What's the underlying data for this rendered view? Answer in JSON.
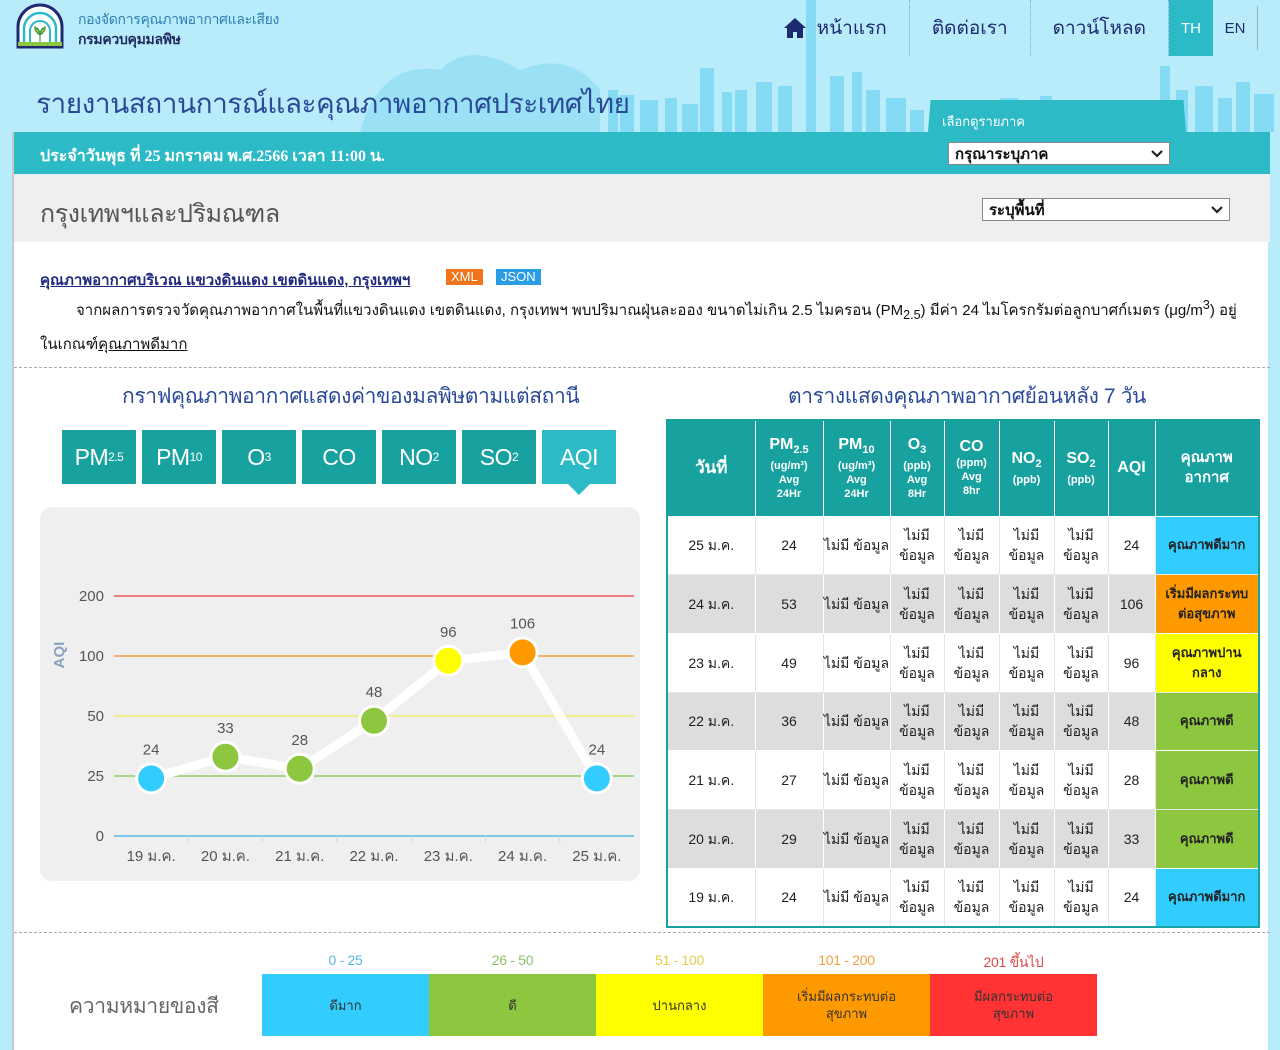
{
  "header": {
    "logo_line1": "กองจัดการคุณภาพอากาศและเสียง",
    "logo_line2": "กรมควบคุมมลพิษ",
    "site_title": "รายงานสถานการณ์และคุณภาพอากาศประเทศไทย",
    "nav": [
      {
        "label": "หน้าแรก",
        "icon": "home-icon"
      },
      {
        "label": "ติดต่อเรา"
      },
      {
        "label": "ดาวน์โหลด"
      }
    ],
    "languages": [
      {
        "label": "TH",
        "active": true
      },
      {
        "label": "EN",
        "active": false
      }
    ],
    "region_tab_label": "เลือกดูรายภาค",
    "region_select_value": "กรุณาระบุภาค"
  },
  "date_bar": {
    "text": "ประจำวันพุธ ที่ 25 มกราคม พ.ศ.2566 เวลา 11:00 น."
  },
  "area": {
    "title": "กรุงเทพฯและปริมณฑล",
    "select_value": "ระบุพื้นที่"
  },
  "info": {
    "link_text": "คุณภาพอากาศบริเวณ แขวงดินแดง เขตดินแดง, กรุงเทพฯ",
    "badge_xml": "XML",
    "badge_json": "JSON",
    "desc_part1": "จากผลการตรวจวัดคุณภาพอากาศในพื้นที่แขวงดินแดง เขตดินแดง, กรุงเทพฯ พบปริมาณฝุ่นละออง ขนาดไม่เกิน 2.5 ไมครอน (PM",
    "desc_sub": "2.5",
    "desc_part2": ") มีค่า 24 ไมโครกรัมต่อลูกบาศก์เมตร (μg/m",
    "desc_sup": "3",
    "desc_part3": ") อยู่ในเกณฑ์",
    "desc_quality": "คุณภาพดีมาก"
  },
  "chart_section": {
    "title": "กราฟคุณภาพอากาศแสดงค่าของมลพิษตามแต่สถานี",
    "tabs": [
      {
        "main": "PM",
        "sub": "2.5",
        "active": false
      },
      {
        "main": "PM",
        "sub": "10",
        "active": false
      },
      {
        "main": "O",
        "sub": "3",
        "active": false
      },
      {
        "main": "CO",
        "sub": "",
        "active": false
      },
      {
        "main": "NO",
        "sub": "2",
        "active": false
      },
      {
        "main": "SO",
        "sub": "2",
        "active": false
      },
      {
        "main": "AQI",
        "sub": "",
        "active": true
      }
    ]
  },
  "chart_data": {
    "type": "line",
    "title": "",
    "xlabel": "",
    "ylabel": "AQI",
    "categories": [
      "19 ม.ค.",
      "20 ม.ค.",
      "21 ม.ค.",
      "22 ม.ค.",
      "23 ม.ค.",
      "24 ม.ค.",
      "25 ม.ค."
    ],
    "series": [
      {
        "name": "AQI",
        "values": [
          24,
          33,
          28,
          48,
          96,
          106,
          24
        ]
      }
    ],
    "y_ticks": [
      0,
      25,
      50,
      100,
      200
    ],
    "y_tick_labels": [
      "0",
      "25",
      "50",
      "100",
      "200"
    ],
    "threshold_lines": [
      {
        "value": 0,
        "color": "#7fc8e8"
      },
      {
        "value": 25,
        "color": "#a9d48a"
      },
      {
        "value": 50,
        "color": "#eef08c"
      },
      {
        "value": 100,
        "color": "#f2b26c"
      },
      {
        "value": 200,
        "color": "#f08080"
      }
    ],
    "point_colors": [
      "#33ccff",
      "#8dc63f",
      "#8dc63f",
      "#8dc63f",
      "#ffff00",
      "#ff9900",
      "#33ccff"
    ],
    "scale": "piecewise",
    "grid": true,
    "legend": "none"
  },
  "table_section": {
    "title": "ตารางแสดงคุณภาพอากาศย้อนหลัง 7 วัน",
    "headers": {
      "date": "วันที่",
      "pm25": {
        "name": "PM",
        "sub": "2.5",
        "unit": "(ug/m³)",
        "avg": "Avg",
        "period": "24Hr"
      },
      "pm10": {
        "name": "PM",
        "sub": "10",
        "unit": "(ug/m³)",
        "avg": "Avg",
        "period": "24Hr"
      },
      "o3": {
        "name": "O",
        "sub": "3",
        "unit": "(ppb)",
        "avg": "Avg",
        "period": "8Hr"
      },
      "co": {
        "name": "CO",
        "sub": "",
        "unit": "(ppm)",
        "avg": "Avg",
        "period": "8hr"
      },
      "no2": {
        "name": "NO",
        "sub": "2",
        "unit": "(ppb)"
      },
      "so2": {
        "name": "SO",
        "sub": "2",
        "unit": "(ppb)"
      },
      "aqi": "AQI",
      "quality_line1": "คุณภาพ",
      "quality_line2": "อากาศ"
    },
    "rows": [
      {
        "date": "25 ม.ค.",
        "pm25": "24",
        "pm10": "ไม่มี ข้อมูล",
        "o3": "ไม่มี ข้อมูล",
        "co": "ไม่มี ข้อมูล",
        "no2": "ไม่มี ข้อมูล",
        "so2": "ไม่มี ข้อมูล",
        "aqi": "24",
        "quality": "คุณภาพดีมาก",
        "quality_color": "#33ccff"
      },
      {
        "date": "24 ม.ค.",
        "pm25": "53",
        "pm10": "ไม่มี ข้อมูล",
        "o3": "ไม่มี ข้อมูล",
        "co": "ไม่มี ข้อมูล",
        "no2": "ไม่มี ข้อมูล",
        "so2": "ไม่มี ข้อมูล",
        "aqi": "106",
        "quality": "เริ่มมีผลกระทบต่อสุขภาพ",
        "quality_color": "#ff9900"
      },
      {
        "date": "23 ม.ค.",
        "pm25": "49",
        "pm10": "ไม่มี ข้อมูล",
        "o3": "ไม่มี ข้อมูล",
        "co": "ไม่มี ข้อมูล",
        "no2": "ไม่มี ข้อมูล",
        "so2": "ไม่มี ข้อมูล",
        "aqi": "96",
        "quality": "คุณภาพปานกลาง",
        "quality_color": "#ffff00"
      },
      {
        "date": "22 ม.ค.",
        "pm25": "36",
        "pm10": "ไม่มี ข้อมูล",
        "o3": "ไม่มี ข้อมูล",
        "co": "ไม่มี ข้อมูล",
        "no2": "ไม่มี ข้อมูล",
        "so2": "ไม่มี ข้อมูล",
        "aqi": "48",
        "quality": "คุณภาพดี",
        "quality_color": "#8dc63f"
      },
      {
        "date": "21 ม.ค.",
        "pm25": "27",
        "pm10": "ไม่มี ข้อมูล",
        "o3": "ไม่มี ข้อมูล",
        "co": "ไม่มี ข้อมูล",
        "no2": "ไม่มี ข้อมูล",
        "so2": "ไม่มี ข้อมูล",
        "aqi": "28",
        "quality": "คุณภาพดี",
        "quality_color": "#8dc63f"
      },
      {
        "date": "20 ม.ค.",
        "pm25": "29",
        "pm10": "ไม่มี ข้อมูล",
        "o3": "ไม่มี ข้อมูล",
        "co": "ไม่มี ข้อมูล",
        "no2": "ไม่มี ข้อมูล",
        "so2": "ไม่มี ข้อมูล",
        "aqi": "33",
        "quality": "คุณภาพดี",
        "quality_color": "#8dc63f"
      },
      {
        "date": "19 ม.ค.",
        "pm25": "24",
        "pm10": "ไม่มี ข้อมูล",
        "o3": "ไม่มี ข้อมูล",
        "co": "ไม่มี ข้อมูล",
        "no2": "ไม่มี ข้อมูล",
        "so2": "ไม่มี ข้อมูล",
        "aqi": "24",
        "quality": "คุณภาพดีมาก",
        "quality_color": "#33ccff"
      }
    ]
  },
  "legend": {
    "title": "ความหมายของสี",
    "items": [
      {
        "range": "0 - 25",
        "label": "ดีมาก",
        "color": "#33ccff",
        "range_color": "#5ab8dc"
      },
      {
        "range": "26 - 50",
        "label": "ดี",
        "color": "#8dc63f",
        "range_color": "#8dc06a"
      },
      {
        "range": "51 - 100",
        "label": "ปานกลาง",
        "color": "#ffff00",
        "range_color": "#e0d04a"
      },
      {
        "range": "101 - 200",
        "label": "เริ่มมีผลกระทบต่อสุขภาพ",
        "color": "#ff9900",
        "range_color": "#f0a040"
      },
      {
        "range": "201 ขึ้นไป",
        "label": "มีผลกระทบต่อสุขภาพ",
        "color": "#ff3333",
        "range_color": "#e04848"
      }
    ]
  }
}
